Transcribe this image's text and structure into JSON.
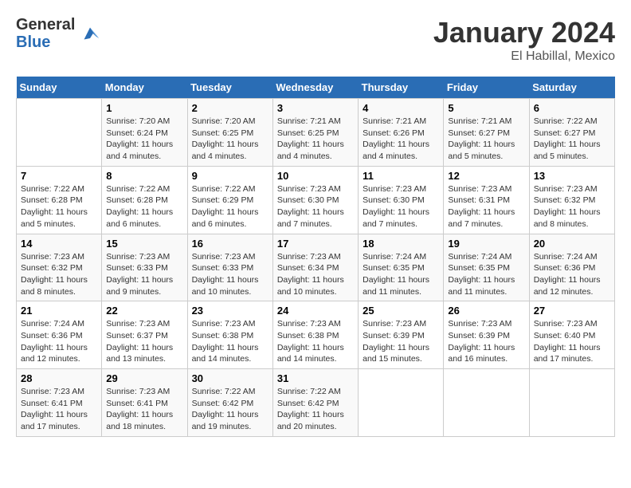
{
  "header": {
    "logo": {
      "general": "General",
      "blue": "Blue"
    },
    "title": "January 2024",
    "location": "El Habillal, Mexico"
  },
  "columns": [
    "Sunday",
    "Monday",
    "Tuesday",
    "Wednesday",
    "Thursday",
    "Friday",
    "Saturday"
  ],
  "weeks": [
    [
      {
        "day": "",
        "info": ""
      },
      {
        "day": "1",
        "info": "Sunrise: 7:20 AM\nSunset: 6:24 PM\nDaylight: 11 hours\nand 4 minutes."
      },
      {
        "day": "2",
        "info": "Sunrise: 7:20 AM\nSunset: 6:25 PM\nDaylight: 11 hours\nand 4 minutes."
      },
      {
        "day": "3",
        "info": "Sunrise: 7:21 AM\nSunset: 6:25 PM\nDaylight: 11 hours\nand 4 minutes."
      },
      {
        "day": "4",
        "info": "Sunrise: 7:21 AM\nSunset: 6:26 PM\nDaylight: 11 hours\nand 4 minutes."
      },
      {
        "day": "5",
        "info": "Sunrise: 7:21 AM\nSunset: 6:27 PM\nDaylight: 11 hours\nand 5 minutes."
      },
      {
        "day": "6",
        "info": "Sunrise: 7:22 AM\nSunset: 6:27 PM\nDaylight: 11 hours\nand 5 minutes."
      }
    ],
    [
      {
        "day": "7",
        "info": "Sunrise: 7:22 AM\nSunset: 6:28 PM\nDaylight: 11 hours\nand 5 minutes."
      },
      {
        "day": "8",
        "info": "Sunrise: 7:22 AM\nSunset: 6:28 PM\nDaylight: 11 hours\nand 6 minutes."
      },
      {
        "day": "9",
        "info": "Sunrise: 7:22 AM\nSunset: 6:29 PM\nDaylight: 11 hours\nand 6 minutes."
      },
      {
        "day": "10",
        "info": "Sunrise: 7:23 AM\nSunset: 6:30 PM\nDaylight: 11 hours\nand 7 minutes."
      },
      {
        "day": "11",
        "info": "Sunrise: 7:23 AM\nSunset: 6:30 PM\nDaylight: 11 hours\nand 7 minutes."
      },
      {
        "day": "12",
        "info": "Sunrise: 7:23 AM\nSunset: 6:31 PM\nDaylight: 11 hours\nand 7 minutes."
      },
      {
        "day": "13",
        "info": "Sunrise: 7:23 AM\nSunset: 6:32 PM\nDaylight: 11 hours\nand 8 minutes."
      }
    ],
    [
      {
        "day": "14",
        "info": "Sunrise: 7:23 AM\nSunset: 6:32 PM\nDaylight: 11 hours\nand 8 minutes."
      },
      {
        "day": "15",
        "info": "Sunrise: 7:23 AM\nSunset: 6:33 PM\nDaylight: 11 hours\nand 9 minutes."
      },
      {
        "day": "16",
        "info": "Sunrise: 7:23 AM\nSunset: 6:33 PM\nDaylight: 11 hours\nand 10 minutes."
      },
      {
        "day": "17",
        "info": "Sunrise: 7:23 AM\nSunset: 6:34 PM\nDaylight: 11 hours\nand 10 minutes."
      },
      {
        "day": "18",
        "info": "Sunrise: 7:24 AM\nSunset: 6:35 PM\nDaylight: 11 hours\nand 11 minutes."
      },
      {
        "day": "19",
        "info": "Sunrise: 7:24 AM\nSunset: 6:35 PM\nDaylight: 11 hours\nand 11 minutes."
      },
      {
        "day": "20",
        "info": "Sunrise: 7:24 AM\nSunset: 6:36 PM\nDaylight: 11 hours\nand 12 minutes."
      }
    ],
    [
      {
        "day": "21",
        "info": "Sunrise: 7:24 AM\nSunset: 6:36 PM\nDaylight: 11 hours\nand 12 minutes."
      },
      {
        "day": "22",
        "info": "Sunrise: 7:23 AM\nSunset: 6:37 PM\nDaylight: 11 hours\nand 13 minutes."
      },
      {
        "day": "23",
        "info": "Sunrise: 7:23 AM\nSunset: 6:38 PM\nDaylight: 11 hours\nand 14 minutes."
      },
      {
        "day": "24",
        "info": "Sunrise: 7:23 AM\nSunset: 6:38 PM\nDaylight: 11 hours\nand 14 minutes."
      },
      {
        "day": "25",
        "info": "Sunrise: 7:23 AM\nSunset: 6:39 PM\nDaylight: 11 hours\nand 15 minutes."
      },
      {
        "day": "26",
        "info": "Sunrise: 7:23 AM\nSunset: 6:39 PM\nDaylight: 11 hours\nand 16 minutes."
      },
      {
        "day": "27",
        "info": "Sunrise: 7:23 AM\nSunset: 6:40 PM\nDaylight: 11 hours\nand 17 minutes."
      }
    ],
    [
      {
        "day": "28",
        "info": "Sunrise: 7:23 AM\nSunset: 6:41 PM\nDaylight: 11 hours\nand 17 minutes."
      },
      {
        "day": "29",
        "info": "Sunrise: 7:23 AM\nSunset: 6:41 PM\nDaylight: 11 hours\nand 18 minutes."
      },
      {
        "day": "30",
        "info": "Sunrise: 7:22 AM\nSunset: 6:42 PM\nDaylight: 11 hours\nand 19 minutes."
      },
      {
        "day": "31",
        "info": "Sunrise: 7:22 AM\nSunset: 6:42 PM\nDaylight: 11 hours\nand 20 minutes."
      },
      {
        "day": "",
        "info": ""
      },
      {
        "day": "",
        "info": ""
      },
      {
        "day": "",
        "info": ""
      }
    ]
  ]
}
